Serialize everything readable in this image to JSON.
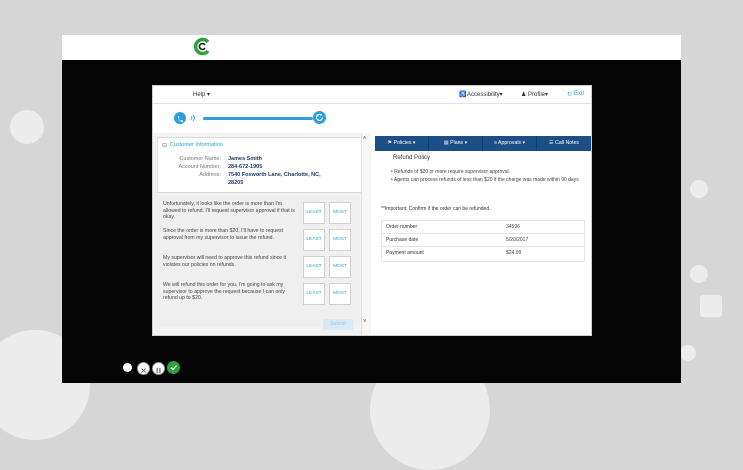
{
  "menu": {
    "help": "Help ▾",
    "accessibility": "Accessibility▾",
    "profile": "Profile▾",
    "exit": "Exit"
  },
  "customer": {
    "section_title": "Customer Information",
    "name_label": "Customer Name:",
    "name": "James Smith",
    "account_label": "Account Number:",
    "account": "284-672-1905",
    "address_label": "Address:",
    "address_line1": "7540 Foxworth Lane, Charlotte, NC,",
    "address_line2": "28205"
  },
  "responses": [
    {
      "text": "Unfortunately, it looks like the order is more than I'm allowed to refund. I'll request supervisor approval if that is okay.",
      "least": "LEAST",
      "most": "MOST"
    },
    {
      "text": "Since the order is more than $20, I'll have to request approval from my supervisor to issue the refund.",
      "least": "LEAST",
      "most": "MOST"
    },
    {
      "text": "My supervisor will need to approve this refund since it violates our policies on refunds.",
      "least": "LEAST",
      "most": "MOST"
    },
    {
      "text": "We will refund this order for you. I'm going to ask my supervisor to approve the request because I can only refund up to $20.",
      "least": "LEAST",
      "most": "MOST"
    }
  ],
  "submit_label": "Submit",
  "tabs": [
    "Policies ▾",
    "Plans ▾",
    "Approvals ▾",
    "Call Notes"
  ],
  "policy": {
    "title": "Refund Policy",
    "bullets": [
      "Refunds of $20 or more require supervisor approval.",
      "Agents can process refunds of less than $20 if the charge was made within 90 days"
    ],
    "important": "**Important: Confirm if the order can be refunded."
  },
  "order_table": [
    {
      "label": "Order number",
      "value": "34596"
    },
    {
      "label": "Purchase date",
      "value": "5/20/2017"
    },
    {
      "label": "Payment amount",
      "value": "$24.99"
    }
  ],
  "colors": {
    "accent": "#2c9fe0",
    "tab_bar": "#1c4f86",
    "brand_green": "#2aa43a"
  }
}
